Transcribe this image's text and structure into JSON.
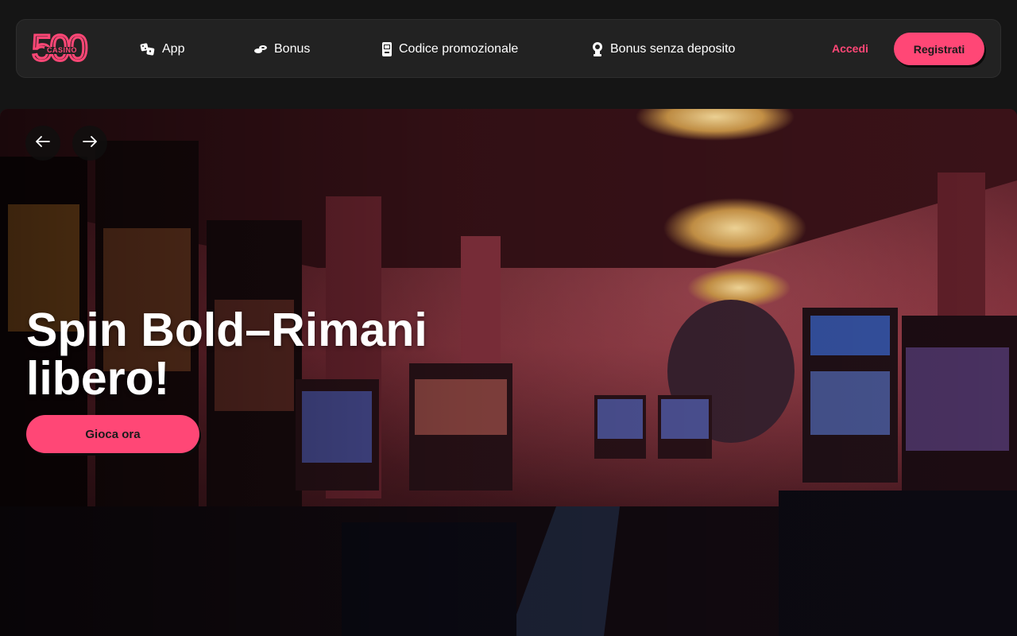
{
  "logo": {
    "number": "500",
    "word": "CASINO"
  },
  "nav": {
    "items": [
      {
        "label": "App",
        "icon": "dice-icon"
      },
      {
        "label": "Bonus",
        "icon": "chips-icon"
      },
      {
        "label": "Codice promozionale",
        "icon": "slot-machine-icon"
      },
      {
        "label": "Bonus senza deposito",
        "icon": "trophy-icon"
      }
    ]
  },
  "auth": {
    "login_label": "Accedi",
    "register_label": "Registrati"
  },
  "hero": {
    "title": "Spin Bold–Rimani libero!",
    "cta_label": "Gioca ora",
    "background": "casino-hall-with-slot-machines-and-chandeliers"
  },
  "colors": {
    "accent": "#ff4776",
    "header_bg": "#222222",
    "page_bg": "#151515"
  }
}
